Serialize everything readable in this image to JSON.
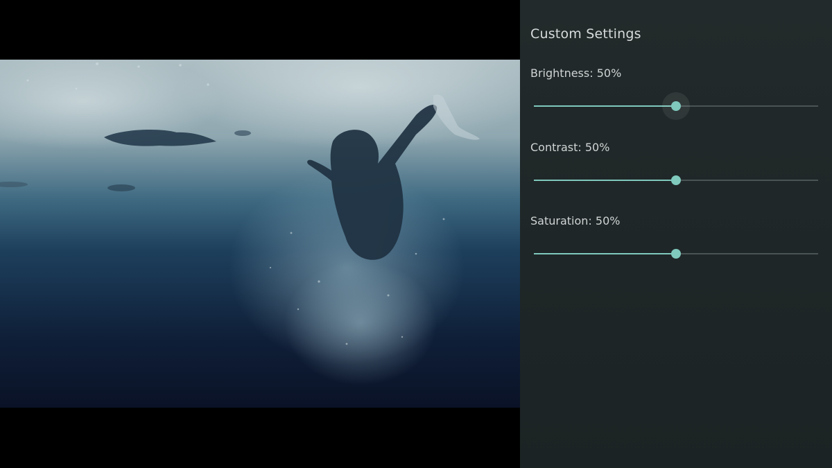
{
  "panel": {
    "title": "Custom Settings",
    "settings": [
      {
        "label": "Brightness: 50%",
        "value": 0.5,
        "focused": true
      },
      {
        "label": "Contrast: 50%",
        "value": 0.5,
        "focused": false
      },
      {
        "label": "Saturation: 50%",
        "value": 0.5,
        "focused": false
      }
    ]
  },
  "colors": {
    "accent": "#7fc9bd",
    "panel_bg": "#20282a",
    "track": "#4a5455"
  }
}
